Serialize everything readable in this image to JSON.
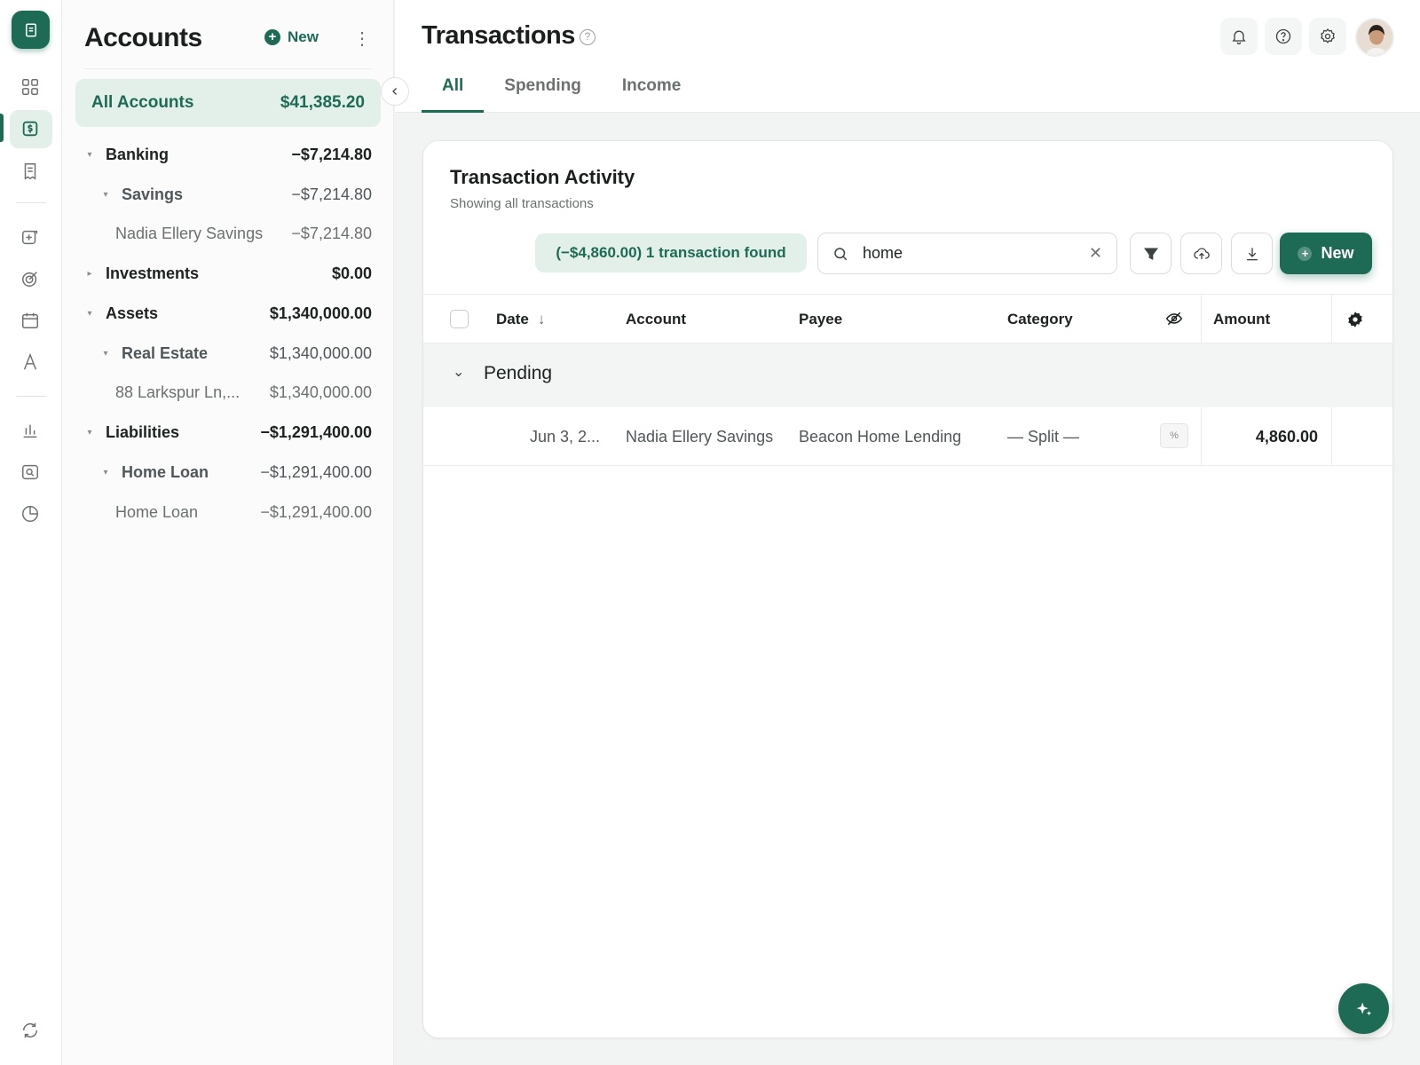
{
  "rail": {
    "icons": [
      "logo-icon",
      "dashboard-icon",
      "accounts-icon",
      "transactions-icon",
      "budget-icon",
      "goals-icon",
      "calendar-icon",
      "rules-icon",
      "reports-icon",
      "search-icon",
      "history-icon",
      "sync-icon"
    ]
  },
  "accounts": {
    "title": "Accounts",
    "new_label": "New",
    "more_label": "⋮",
    "all": {
      "label": "All Accounts",
      "amount": "$41,385.20"
    },
    "tree": [
      {
        "label": "Banking",
        "amount": "−$7,214.80",
        "level": 0,
        "caret": "▾"
      },
      {
        "label": "Savings",
        "amount": "−$7,214.80",
        "level": 1,
        "caret": "▾"
      },
      {
        "label": "Nadia Ellery Savings",
        "amount": "−$7,214.80",
        "level": 2,
        "caret": ""
      },
      {
        "label": "Investments",
        "amount": "$0.00",
        "level": 0,
        "caret": "▸"
      },
      {
        "label": "Assets",
        "amount": "$1,340,000.00",
        "level": 0,
        "caret": "▾"
      },
      {
        "label": "Real Estate",
        "amount": "$1,340,000.00",
        "level": 1,
        "caret": "▾"
      },
      {
        "label": "88 Larkspur Ln,...",
        "amount": "$1,340,000.00",
        "level": 2,
        "caret": ""
      },
      {
        "label": "Liabilities",
        "amount": "−$1,291,400.00",
        "level": 0,
        "caret": "▾"
      },
      {
        "label": "Home Loan",
        "amount": "−$1,291,400.00",
        "level": 1,
        "caret": "▾"
      },
      {
        "label": "Home Loan",
        "amount": "−$1,291,400.00",
        "level": 2,
        "caret": ""
      }
    ]
  },
  "header": {
    "title": "Transactions",
    "help_glyph": "?",
    "tabs": [
      "All",
      "Spending",
      "Income"
    ],
    "active_tab": "All"
  },
  "card": {
    "title": "Transaction Activity",
    "subtitle": "Showing all transactions",
    "found_badge": "(−$4,860.00) 1 transaction found",
    "search": {
      "value": "home",
      "clear": "✕"
    },
    "new_label": "New",
    "plus": "+",
    "columns": {
      "date": "Date",
      "sort_arrow": "↓",
      "account": "Account",
      "payee": "Payee",
      "category": "Category",
      "amount": "Amount"
    },
    "group": {
      "label": "Pending",
      "chevron": "⌄"
    },
    "rows": [
      {
        "date": "Jun 3, 2...",
        "account": "Nadia Ellery Savings",
        "payee": "Beacon Home Lending",
        "category": "— Split —",
        "split_glyph": "%",
        "amount": "4,860.00"
      }
    ]
  },
  "colors": {
    "brand": "#1e6b55",
    "brand_light": "#e3f0ea"
  }
}
